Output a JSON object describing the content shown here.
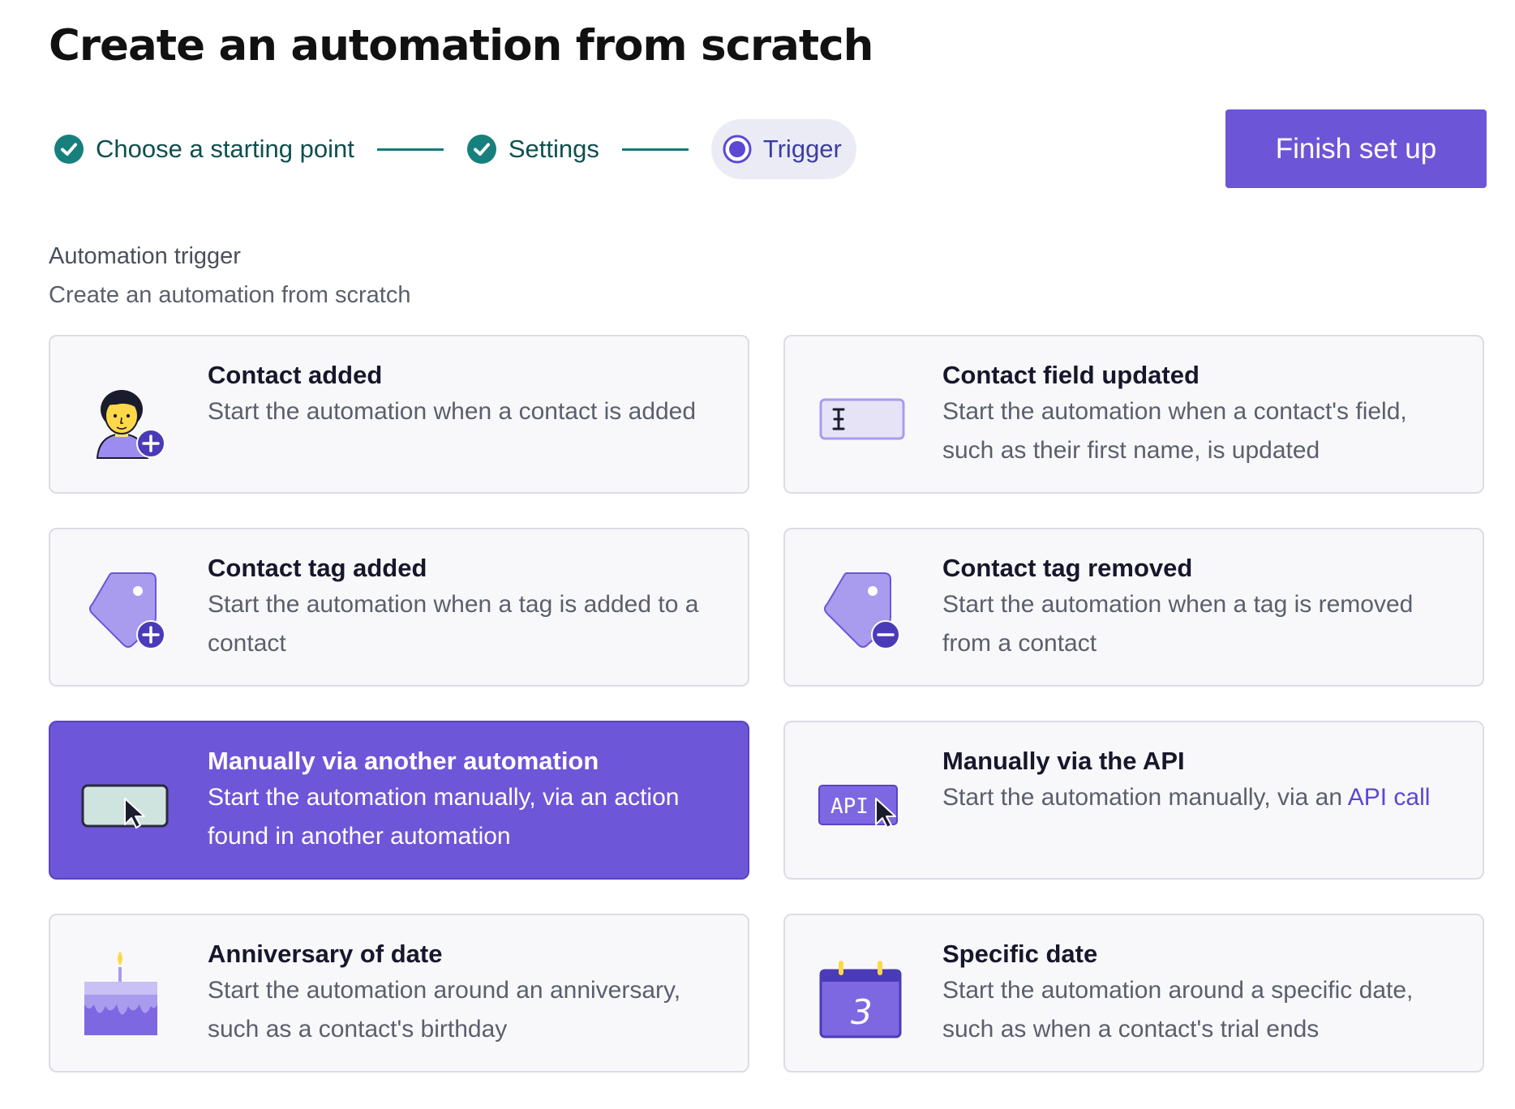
{
  "page": {
    "title": "Create an automation from scratch"
  },
  "stepper": {
    "steps": [
      {
        "label": "Choose a starting point",
        "state": "complete"
      },
      {
        "label": "Settings",
        "state": "complete"
      },
      {
        "label": "Trigger",
        "state": "current"
      }
    ]
  },
  "actions": {
    "finish_label": "Finish set up"
  },
  "section": {
    "title": "Automation trigger",
    "subtitle": "Create an automation from scratch"
  },
  "triggers": [
    {
      "title": "Contact added",
      "description": "Start the automation when a contact is added",
      "icon": "contact-add-icon"
    },
    {
      "title": "Contact field updated",
      "description": "Start the automation when a contact's field, such as their first name, is updated",
      "icon": "text-field-icon"
    },
    {
      "title": "Contact tag added",
      "description": "Start the automation when a tag is added to a contact",
      "icon": "tag-add-icon"
    },
    {
      "title": "Contact tag removed",
      "description": "Start the automation when a tag is removed from a contact",
      "icon": "tag-remove-icon"
    },
    {
      "title": "Manually via another automation",
      "description": "Start the automation manually, via an action found in another automation",
      "icon": "button-cursor-icon",
      "selected": true
    },
    {
      "title": "Manually via the API",
      "description_prefix": "Start the automation manually, via an ",
      "link_text": "API call",
      "icon": "api-cursor-icon"
    },
    {
      "title": "Anniversary of date",
      "description": "Start the automation around an anniversary, such as a contact's birthday",
      "icon": "cake-icon"
    },
    {
      "title": "Specific date",
      "description": "Start the automation around a specific date, such as when a contact's trial ends",
      "icon": "calendar-icon"
    }
  ],
  "colors": {
    "accent": "#6d55d8",
    "step_complete": "#127a78",
    "card_bg": "#f8f8fa",
    "card_border": "#dcdce6",
    "link": "#5b48d4"
  }
}
